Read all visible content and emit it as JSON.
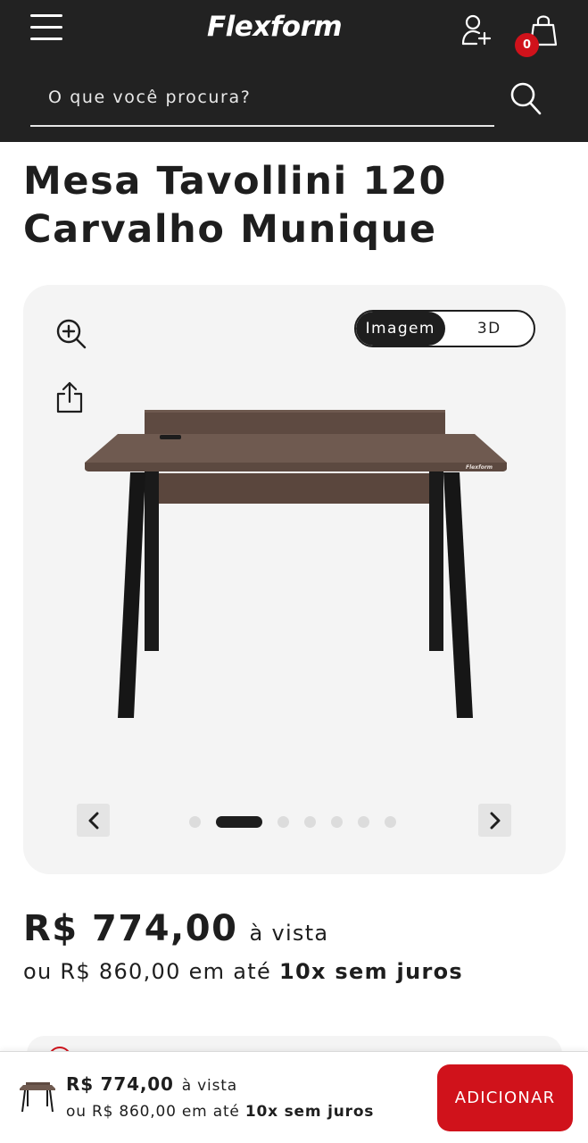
{
  "header": {
    "logo_text": "Flexform",
    "cart_count": "0",
    "search_placeholder": "O que você procura?"
  },
  "product": {
    "title_line1": "Mesa Tavollini 120",
    "title_line2": "Carvalho Munique"
  },
  "gallery": {
    "view_options": [
      "Imagem",
      "3D"
    ],
    "active_view": "Imagem",
    "image_count": 7,
    "active_index": 1,
    "product_brand_mark": "Flexform"
  },
  "pricing": {
    "cash_price": "R$ 774,00",
    "cash_suffix": "à vista",
    "installment_prefix": "ou R$ 860,00 em até",
    "installment_terms": "10x sem juros"
  },
  "sticky_bar": {
    "cash_price": "R$ 774,00",
    "cash_suffix": "à vista",
    "installment_prefix": "ou R$ 860,00 em até",
    "installment_terms": "10x sem juros",
    "add_button_label": "ADICIONAR"
  },
  "colors": {
    "header_bg": "#222222",
    "accent_red": "#d0121b",
    "gallery_bg": "#f4f4f4",
    "text_dark": "#1e1e1e"
  },
  "icons": [
    "menu-icon",
    "user-add-icon",
    "shopping-bag-icon",
    "search-icon",
    "zoom-in-icon",
    "share-icon",
    "chevron-left-icon",
    "chevron-right-icon"
  ]
}
